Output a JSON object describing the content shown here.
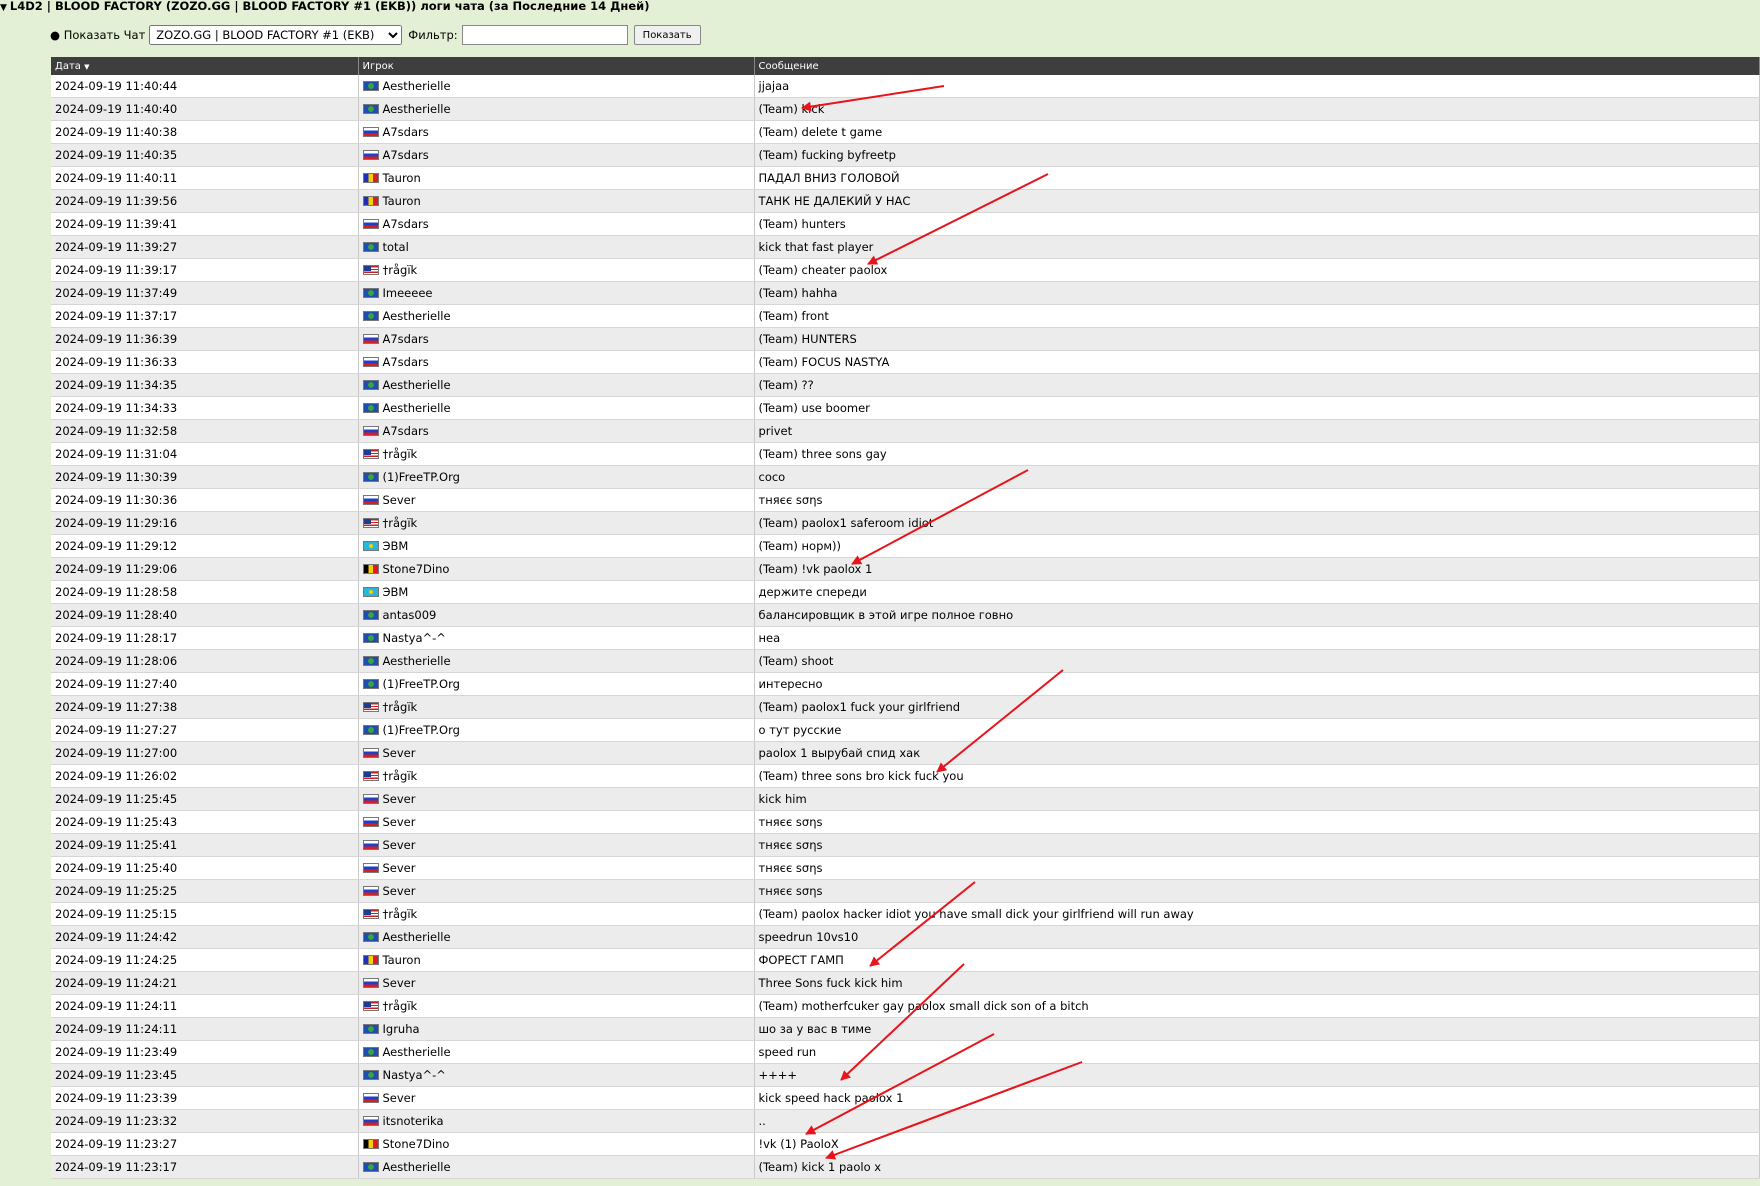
{
  "header": {
    "title": "L4D2 | BLOOD FACTORY (ZOZO.GG | BLOOD FACTORY #1 (EKB)) логи чата (за Последние 14 Дней)"
  },
  "controls": {
    "show_chat_label": "● Показать Чат",
    "chat_select_value": "ZOZO.GG | BLOOD FACTORY #1 (EKB)",
    "filter_label": "Фильтр:",
    "filter_value": "",
    "show_button": "Показать"
  },
  "table": {
    "headers": {
      "date": "Дата",
      "sort_indicator": "▼",
      "player": "Игрок",
      "message": "Сообщение"
    },
    "rows": [
      {
        "date": "2024-09-19 11:40:44",
        "flag": "un",
        "player": "Aestherielle",
        "message": "jjajaa"
      },
      {
        "date": "2024-09-19 11:40:40",
        "flag": "un",
        "player": "Aestherielle",
        "message": "(Team) kick"
      },
      {
        "date": "2024-09-19 11:40:38",
        "flag": "ru",
        "player": "A7sdars",
        "message": "(Team) delete t game"
      },
      {
        "date": "2024-09-19 11:40:35",
        "flag": "ru",
        "player": "A7sdars",
        "message": "(Team) fucking byfreetp"
      },
      {
        "date": "2024-09-19 11:40:11",
        "flag": "ro",
        "player": "Tauron",
        "message": "ПАДАЛ ВНИЗ ГОЛОВОЙ"
      },
      {
        "date": "2024-09-19 11:39:56",
        "flag": "ro",
        "player": "Tauron",
        "message": "ТАНК НЕ ДАЛЕКИЙ У НАС"
      },
      {
        "date": "2024-09-19 11:39:41",
        "flag": "ru",
        "player": "A7sdars",
        "message": "(Team) hunters"
      },
      {
        "date": "2024-09-19 11:39:27",
        "flag": "un",
        "player": "total",
        "message": "kick that fast player"
      },
      {
        "date": "2024-09-19 11:39:17",
        "flag": "us",
        "player": "†rågïk",
        "message": "(Team) cheater paolox"
      },
      {
        "date": "2024-09-19 11:37:49",
        "flag": "un",
        "player": "Imeeeee",
        "message": "(Team) hahha"
      },
      {
        "date": "2024-09-19 11:37:17",
        "flag": "un",
        "player": "Aestherielle",
        "message": "(Team) front"
      },
      {
        "date": "2024-09-19 11:36:39",
        "flag": "ru",
        "player": "A7sdars",
        "message": "(Team) HUNTERS"
      },
      {
        "date": "2024-09-19 11:36:33",
        "flag": "ru",
        "player": "A7sdars",
        "message": "(Team) FOCUS NASTYA"
      },
      {
        "date": "2024-09-19 11:34:35",
        "flag": "un",
        "player": "Aestherielle",
        "message": "(Team) ??"
      },
      {
        "date": "2024-09-19 11:34:33",
        "flag": "un",
        "player": "Aestherielle",
        "message": "(Team) use boomer"
      },
      {
        "date": "2024-09-19 11:32:58",
        "flag": "ru",
        "player": "A7sdars",
        "message": "privet"
      },
      {
        "date": "2024-09-19 11:31:04",
        "flag": "us",
        "player": "†rågïk",
        "message": "(Team) three sons gay"
      },
      {
        "date": "2024-09-19 11:30:39",
        "flag": "un",
        "player": "(1)FreeTP.Org",
        "message": "coco"
      },
      {
        "date": "2024-09-19 11:30:36",
        "flag": "ru",
        "player": "Sever",
        "message": "тняєє ѕσηѕ"
      },
      {
        "date": "2024-09-19 11:29:16",
        "flag": "us",
        "player": "†rågïk",
        "message": "(Team) paolox1 saferoom idiot"
      },
      {
        "date": "2024-09-19 11:29:12",
        "flag": "kz",
        "player": "ЭВМ",
        "message": "(Team) норм))"
      },
      {
        "date": "2024-09-19 11:29:06",
        "flag": "be",
        "player": "Stone7Dino",
        "message": "(Team) !vk paolox 1"
      },
      {
        "date": "2024-09-19 11:28:58",
        "flag": "kz",
        "player": "ЭВМ",
        "message": "держите спереди"
      },
      {
        "date": "2024-09-19 11:28:40",
        "flag": "un",
        "player": "antas009",
        "message": "балансировщик в этой игре полное говно"
      },
      {
        "date": "2024-09-19 11:28:17",
        "flag": "un",
        "player": "Nastya^-^",
        "message": "неа"
      },
      {
        "date": "2024-09-19 11:28:06",
        "flag": "un",
        "player": "Aestherielle",
        "message": "(Team) shoot"
      },
      {
        "date": "2024-09-19 11:27:40",
        "flag": "un",
        "player": "(1)FreeTP.Org",
        "message": "интересно"
      },
      {
        "date": "2024-09-19 11:27:38",
        "flag": "us",
        "player": "†rågïk",
        "message": "(Team) paolox1 fuck your girlfriend"
      },
      {
        "date": "2024-09-19 11:27:27",
        "flag": "un",
        "player": "(1)FreeTP.Org",
        "message": "о тут русские"
      },
      {
        "date": "2024-09-19 11:27:00",
        "flag": "ru",
        "player": "Sever",
        "message": "paolox 1 вырубай спид хак"
      },
      {
        "date": "2024-09-19 11:26:02",
        "flag": "us",
        "player": "†rågïk",
        "message": "(Team) three sons bro kick fuck you"
      },
      {
        "date": "2024-09-19 11:25:45",
        "flag": "ru",
        "player": "Sever",
        "message": "kick him"
      },
      {
        "date": "2024-09-19 11:25:43",
        "flag": "ru",
        "player": "Sever",
        "message": "тняєє ѕσηѕ"
      },
      {
        "date": "2024-09-19 11:25:41",
        "flag": "ru",
        "player": "Sever",
        "message": "тняєє ѕσηѕ"
      },
      {
        "date": "2024-09-19 11:25:40",
        "flag": "ru",
        "player": "Sever",
        "message": "тняєє ѕσηѕ"
      },
      {
        "date": "2024-09-19 11:25:25",
        "flag": "ru",
        "player": "Sever",
        "message": "тняєє ѕσηѕ"
      },
      {
        "date": "2024-09-19 11:25:15",
        "flag": "us",
        "player": "†rågïk",
        "message": "(Team) paolox hacker idiot you have small dick your girlfriend will run away"
      },
      {
        "date": "2024-09-19 11:24:42",
        "flag": "un",
        "player": "Aestherielle",
        "message": "speedrun 10vs10"
      },
      {
        "date": "2024-09-19 11:24:25",
        "flag": "ro",
        "player": "Tauron",
        "message": "ФОРЕСТ ГАМП"
      },
      {
        "date": "2024-09-19 11:24:21",
        "flag": "ru",
        "player": "Sever",
        "message": "Three Sons fuck kick him"
      },
      {
        "date": "2024-09-19 11:24:11",
        "flag": "us",
        "player": "†rågïk",
        "message": "(Team) motherfcuker gay paolox small dick son of a bitch"
      },
      {
        "date": "2024-09-19 11:24:11",
        "flag": "un",
        "player": "Igruha",
        "message": "шо за у вас в тиме"
      },
      {
        "date": "2024-09-19 11:23:49",
        "flag": "un",
        "player": "Aestherielle",
        "message": "speed run"
      },
      {
        "date": "2024-09-19 11:23:45",
        "flag": "un",
        "player": "Nastya^-^",
        "message": "++++"
      },
      {
        "date": "2024-09-19 11:23:39",
        "flag": "ru",
        "player": "Sever",
        "message": "kick speed hack paolox 1"
      },
      {
        "date": "2024-09-19 11:23:32",
        "flag": "ru",
        "player": "itsnoterika",
        "message": ".."
      },
      {
        "date": "2024-09-19 11:23:27",
        "flag": "be",
        "player": "Stone7Dino",
        "message": "!vk (1) PaoloX"
      },
      {
        "date": "2024-09-19 11:23:17",
        "flag": "un",
        "player": "Aestherielle",
        "message": "(Team) kick 1 paolo x"
      }
    ]
  },
  "annotations": {
    "arrow_color": "#e8141b"
  }
}
